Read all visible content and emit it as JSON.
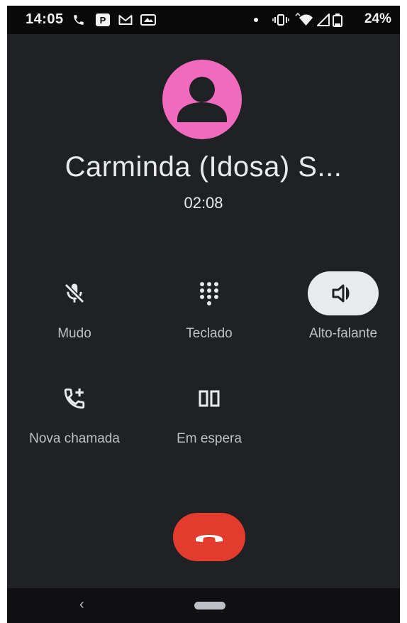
{
  "status_bar": {
    "time": "14:05",
    "battery": "24%",
    "left_icons": [
      "phone-call-icon",
      "parking-app-icon",
      "gmail-icon",
      "cast-icon"
    ],
    "right_icons": [
      "dot-icon",
      "vibrate-icon",
      "wifi-icon",
      "signal-icon",
      "battery-icon"
    ]
  },
  "call": {
    "caller_name": "Carminda (Idosa) S...",
    "duration": "02:08",
    "avatar_color": "#f06bbe"
  },
  "controls": [
    {
      "label": "Mudo",
      "icon": "mic-off-icon",
      "active": false
    },
    {
      "label": "Teclado",
      "icon": "dialpad-icon",
      "active": false
    },
    {
      "label": "Alto-falante",
      "icon": "speaker-icon",
      "active": true
    },
    {
      "label": "Nova chamada",
      "icon": "add-call-icon",
      "active": false
    },
    {
      "label": "Em espera",
      "icon": "pause-icon",
      "active": false
    }
  ],
  "end_call": {
    "icon": "call-end-icon",
    "color": "#e33b2e"
  },
  "nav_bar": {
    "back_glyph": "‹",
    "home_icon": "home-pill-icon"
  },
  "colors": {
    "background": "#202124",
    "text": "#e8eaed",
    "label": "#bdc1c6",
    "active_button": "#e8eaed"
  }
}
